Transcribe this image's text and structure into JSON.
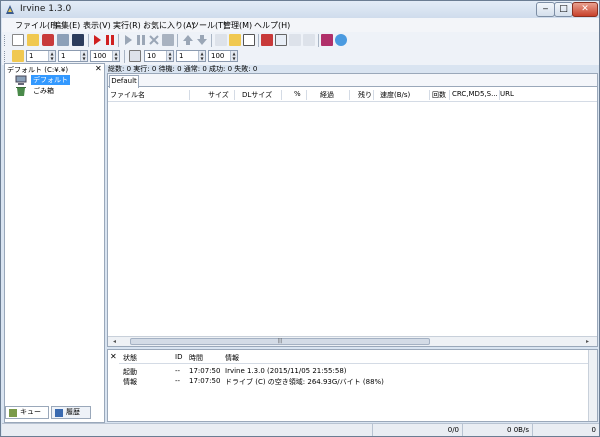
{
  "window": {
    "title": "Irvine 1.3.0"
  },
  "menu": [
    {
      "label": "ファイル(F)",
      "name": "menu-file"
    },
    {
      "label": "編集(E)",
      "name": "menu-edit"
    },
    {
      "label": "表示(V)",
      "name": "menu-view"
    },
    {
      "label": "実行(R)",
      "name": "menu-run"
    },
    {
      "label": "お気に入り(A)",
      "name": "menu-favorites"
    },
    {
      "label": "ツール(T)",
      "name": "menu-tools"
    },
    {
      "label": "管理(M)",
      "name": "menu-manage"
    },
    {
      "label": "ヘルプ(H)",
      "name": "menu-help"
    }
  ],
  "toolbar2": {
    "spin1": "1",
    "spin2": "1",
    "spin3": "100",
    "spin4": "10",
    "spin5": "1",
    "spin6": "100"
  },
  "left": {
    "header": "デフォルト (C:¥.¥)",
    "tree": [
      {
        "label": "デフォルト",
        "selected": true
      },
      {
        "label": "ごみ箱",
        "selected": false
      }
    ],
    "tabs": {
      "queue": "キュー",
      "history": "履歴"
    }
  },
  "stats": "総数: 0  実行: 0  待機: 0  通常: 0  成功: 0  失敗: 0",
  "main": {
    "tab": "Default",
    "columns": [
      "ファイル名",
      "サイズ",
      "DLサイズ",
      "%",
      "経過",
      "残り",
      "速度(B/s)",
      "回数",
      "CRC,MD5,S...",
      "URL"
    ],
    "scroll_thumb": "|||"
  },
  "log": {
    "columns": [
      "状態",
      "ID",
      "時間",
      "情報"
    ],
    "rows": [
      {
        "state": "起動",
        "id": "--",
        "time": "17:07:50",
        "info": "Irvine 1.3.0 (2015/11/05 21:55:58)"
      },
      {
        "state": "情報",
        "id": "--",
        "time": "17:07:50",
        "info": "ドライブ (C) の空き領域: 264.93G/バイト (88%)"
      }
    ]
  },
  "statusbar": {
    "progress": "0/0",
    "speed": "0 0B/s",
    "count": "0"
  }
}
